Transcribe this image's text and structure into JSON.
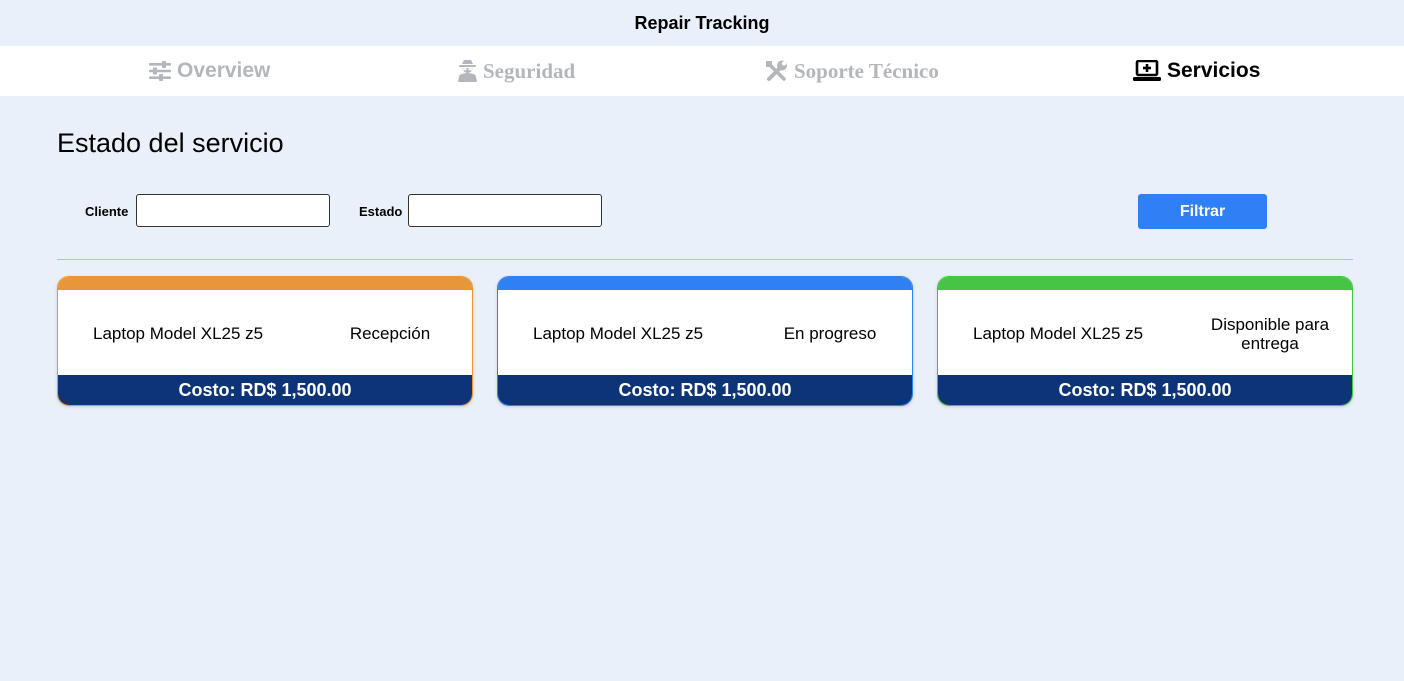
{
  "app": {
    "title": "Repair Tracking"
  },
  "tabs": [
    {
      "label": "Overview",
      "icon": "sliders-icon",
      "active": false
    },
    {
      "label": "Seguridad",
      "icon": "user-secret-icon",
      "active": false
    },
    {
      "label": "Soporte Técnico",
      "icon": "tools-icon",
      "active": false
    },
    {
      "label": "Servicios",
      "icon": "laptop-medical-icon",
      "active": true
    }
  ],
  "main": {
    "title": "Estado del servicio",
    "filters": {
      "cliente_label": "Cliente",
      "cliente_value": "",
      "estado_label": "Estado",
      "estado_value": "",
      "button_label": "Filtrar"
    },
    "cards": [
      {
        "model": "Laptop Model XL25 z5",
        "status": "Recepción",
        "cost": "Costo: RD$ 1,500.00",
        "accent_color": "#e8963a"
      },
      {
        "model": "Laptop Model XL25 z5",
        "status": "En progreso",
        "cost": "Costo: RD$ 1,500.00",
        "accent_color": "#2f7ff5"
      },
      {
        "model": "Laptop Model XL25 z5",
        "status": "Disponible para entrega",
        "cost": "Costo: RD$ 1,500.00",
        "accent_color": "#47c446"
      }
    ]
  },
  "colors": {
    "background": "#eaf0f9",
    "primary_button": "#2f7ff5",
    "card_footer": "#0e3478",
    "inactive_tab": "#b3b6bb"
  }
}
